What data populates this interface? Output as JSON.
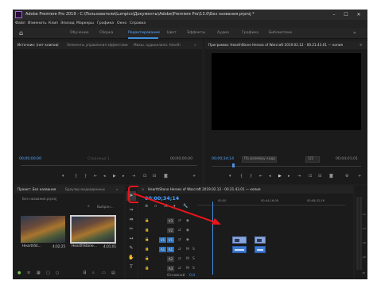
{
  "titlebar": {
    "title": "Adobe Premiere Pro 2019 - C:\\Пользователи\\Lumpics\\Документы\\Adobe\\Premiere Pro\\13.0\\Без названия.prproj *",
    "minimize": "–",
    "maximize": "☐",
    "close": "✕"
  },
  "menu": [
    "Файл",
    "Изменить",
    "Клип",
    "Эпизод",
    "Маркеры",
    "Графика",
    "Окно",
    "Справка"
  ],
  "workspaces": {
    "home_icon": "home-icon",
    "tabs": [
      {
        "label": "Обучение"
      },
      {
        "label": "Сборка"
      },
      {
        "label": "Редактирование"
      },
      {
        "label": "Цвет"
      },
      {
        "label": "Эффекты"
      },
      {
        "label": "Аудио"
      },
      {
        "label": "Графика"
      },
      {
        "label": "Библиотеки"
      }
    ],
    "active_tab": "Редактирование",
    "more": "»"
  },
  "source_panel": {
    "tabs": [
      "Источник: (нет клипов)",
      "Элементы управления эффектами",
      "Микш. аудиоклипа: Hearth",
      "»"
    ],
    "timecode_left": "00;00;00;00",
    "page_label": "Страница 1",
    "timecode_right": "00;00;00;00"
  },
  "program_panel": {
    "tab": "Программа: HearthStone Heroes of Warcraft 2019.02.12 - 00.21.43.01 — копия",
    "menu_icon": "≡",
    "timecode": "00;00;34;14",
    "fit_label": "По размеру кадр",
    "resolution": "1/2",
    "duration": "00;04;01;01"
  },
  "project_panel": {
    "tab": "Проект: Без названия",
    "tab2": "Браузер медиаданных",
    "more": "»",
    "file": "Без названия.prproj",
    "search_placeholder": "Выбран...",
    "items": [
      {
        "name": "HearthSt...",
        "duration": "4;02;25"
      },
      {
        "name": "HearthStone...",
        "duration": "4;01;01"
      }
    ]
  },
  "timeline": {
    "tab": "HearthStone Heroes of Warcraft 2019.02.12 - 00.21.43.01 — копия",
    "timecode": "00;00;34;14",
    "ruler_labels": [
      "00;00",
      "00;04;16;08",
      "00;08;32;16"
    ],
    "video_tracks": [
      "V3",
      "V2",
      "V1"
    ],
    "audio_tracks": [
      "A1",
      "A2",
      "A3"
    ],
    "source_patch_video": "V1",
    "source_patch_audio": "A1",
    "mute_label": "M",
    "solo_label": "S",
    "master_label": "Основной",
    "master_value": "0,0"
  },
  "meter": {
    "labels": [
      "-12",
      "-24",
      "-36",
      "-48",
      "dB"
    ]
  },
  "annotation": {
    "color": "#e8141c"
  }
}
